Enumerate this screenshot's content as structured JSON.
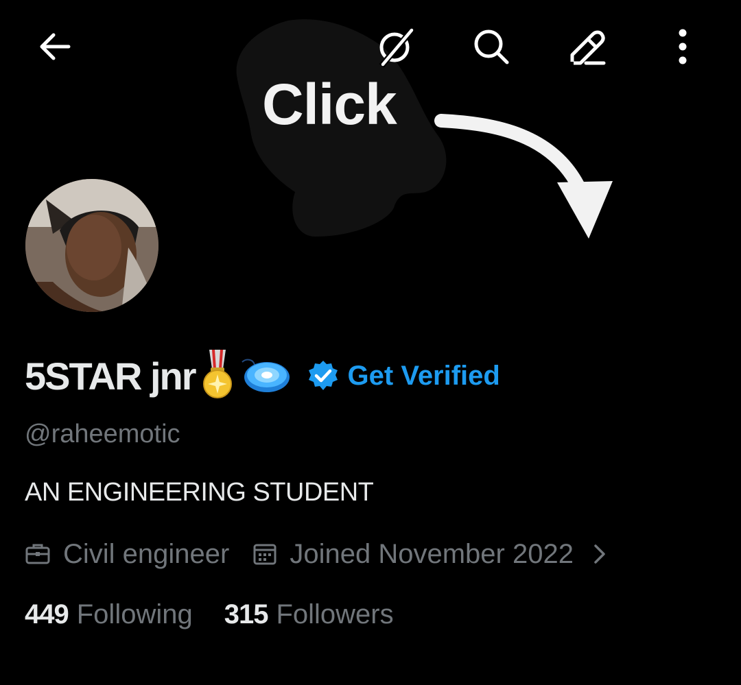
{
  "overlay": {
    "annotation_text": "Click"
  },
  "header": {
    "back_icon": "arrow-left-icon",
    "grok_icon": "grok-icon",
    "search_icon": "search-icon",
    "edit_icon": "pencil-icon",
    "more_icon": "more-vertical-icon"
  },
  "profile": {
    "display_name": "5STAR jnr",
    "badges": [
      "military-medal-emoji",
      "spinning-disc-emoji"
    ],
    "get_verified_label": "Get Verified",
    "handle": "@raheemotic",
    "bio": "AN ENGINEERING STUDENT",
    "profession": "Civil engineer",
    "joined": "Joined November 2022",
    "following_count": "449",
    "following_label": "Following",
    "followers_count": "315",
    "followers_label": "Followers"
  },
  "colors": {
    "background": "#000000",
    "primary_text": "#e7e9ea",
    "secondary_text": "#71767b",
    "accent_blue": "#1d9bf0"
  }
}
